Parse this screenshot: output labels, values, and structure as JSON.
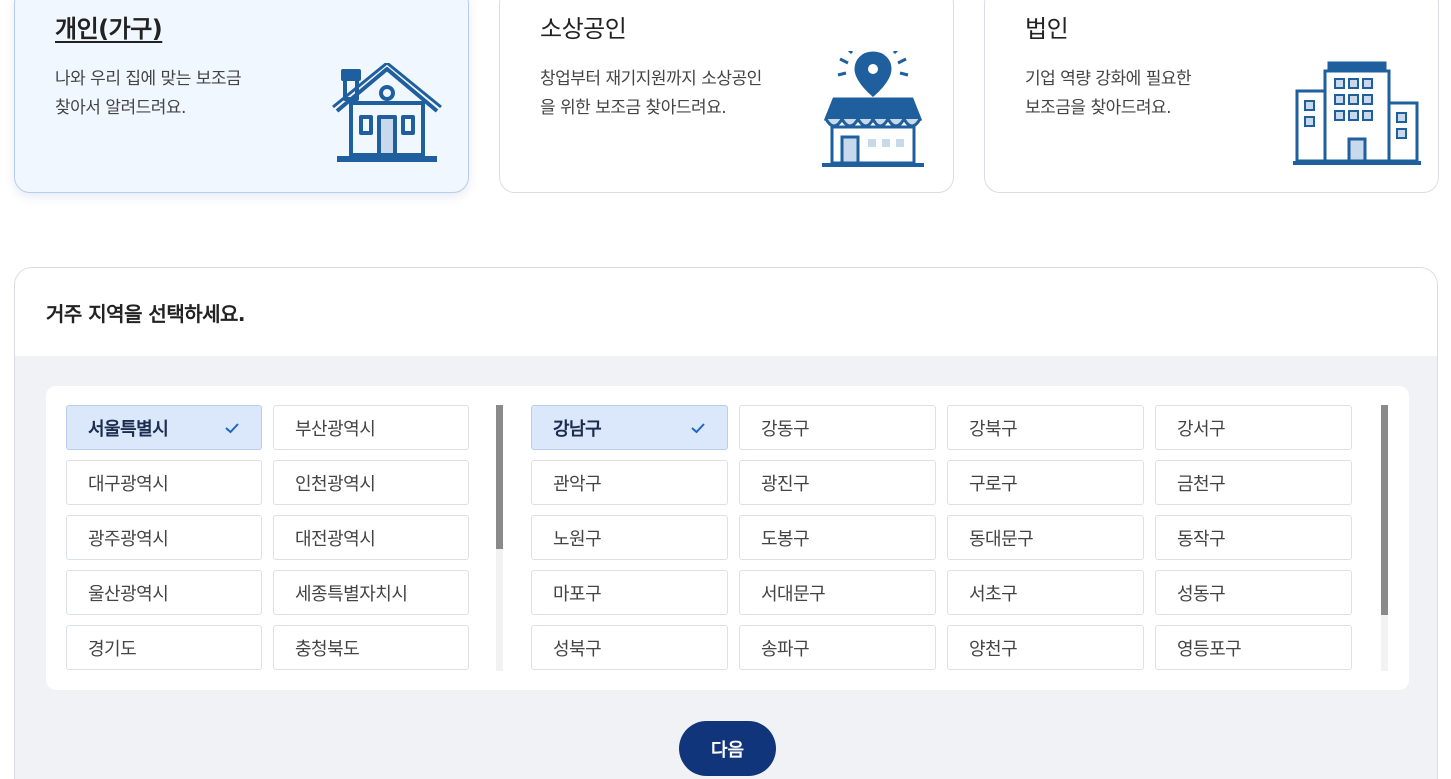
{
  "cards": [
    {
      "title": "개인(가구)",
      "desc_line1": "나와 우리 집에 맞는 보조금",
      "desc_line2": "찾아서 알려드려요.",
      "icon": "house-icon",
      "active": true
    },
    {
      "title": "소상공인",
      "desc_line1": "창업부터 재기지원까지 소상공인",
      "desc_line2": "을 위한 보조금 찾아드려요.",
      "icon": "store-icon",
      "active": false
    },
    {
      "title": "법인",
      "desc_line1": "기업 역량 강화에 필요한",
      "desc_line2": "보조금을 찾아드려요.",
      "icon": "building-icon",
      "active": false
    }
  ],
  "region": {
    "title": "거주 지역을 선택하세요.",
    "provinces": [
      "서울특별시",
      "부산광역시",
      "대구광역시",
      "인천광역시",
      "광주광역시",
      "대전광역시",
      "울산광역시",
      "세종특별자치시",
      "경기도",
      "충청북도"
    ],
    "selected_province": "서울특별시",
    "districts": [
      "강남구",
      "강동구",
      "강북구",
      "강서구",
      "관악구",
      "광진구",
      "구로구",
      "금천구",
      "노원구",
      "도봉구",
      "동대문구",
      "동작구",
      "마포구",
      "서대문구",
      "서초구",
      "성동구",
      "성북구",
      "송파구",
      "양천구",
      "영등포구"
    ],
    "selected_district": "강남구",
    "province_scroll_fraction": 0.54,
    "district_scroll_fraction": 0.79,
    "check_icon": "check-icon"
  },
  "next_label": "다음",
  "colors": {
    "accent": "#10357a",
    "icon": "#1f5f9e",
    "selected_bg": "#dbe7fb"
  }
}
